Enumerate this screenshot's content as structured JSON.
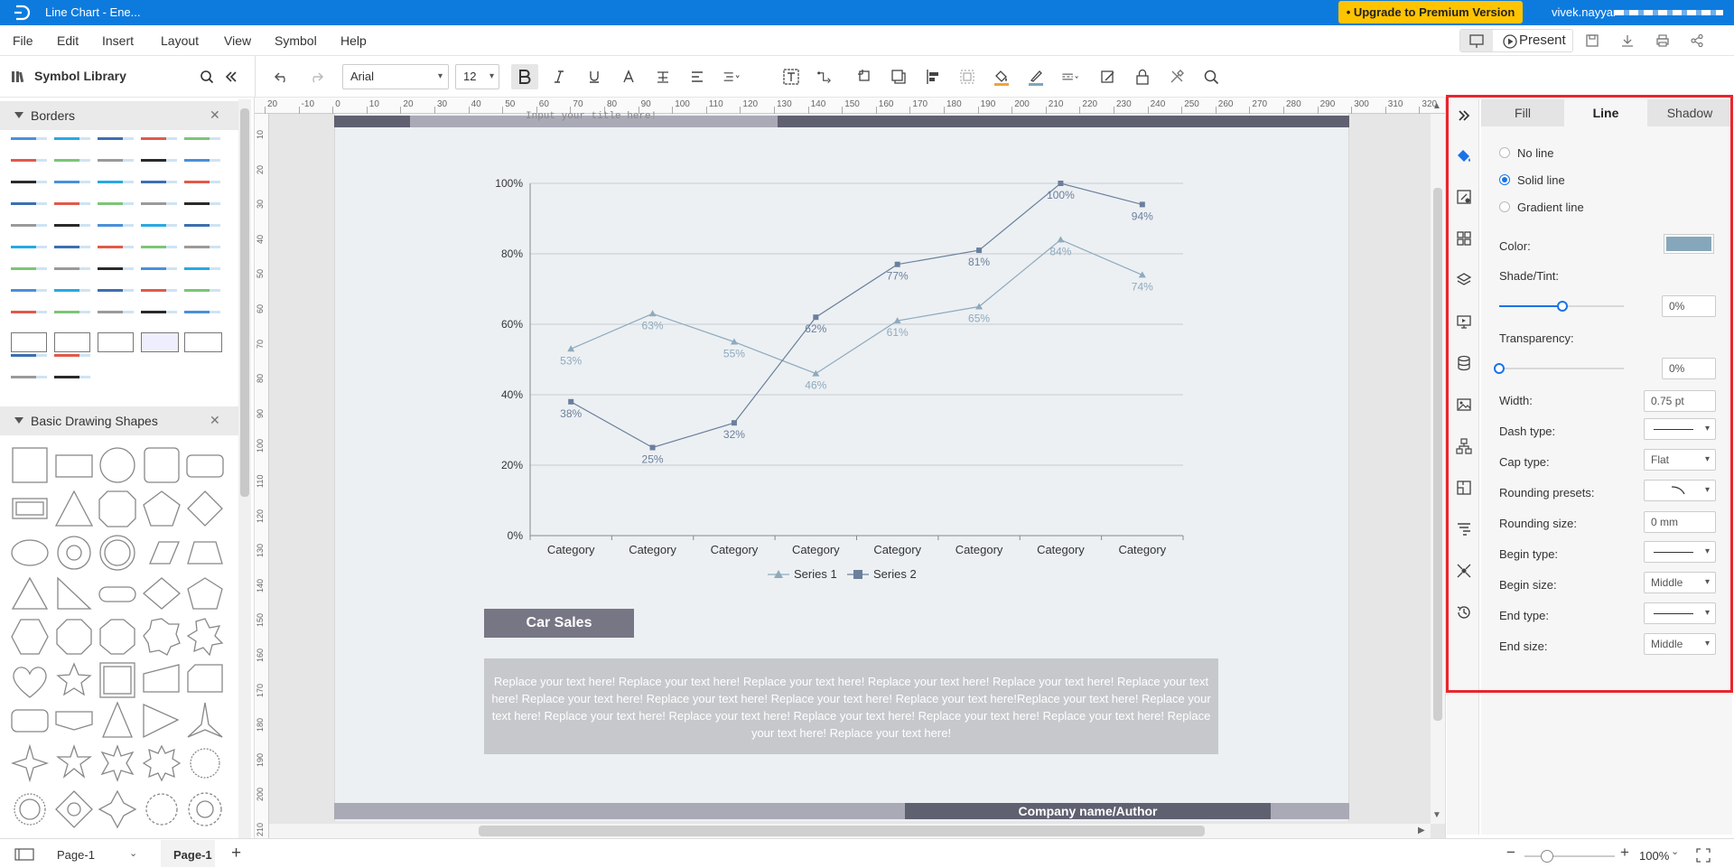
{
  "window": {
    "title": "Line Chart - Ene...",
    "upgrade_label": "• Upgrade to Premium Version",
    "user": "vivek.nayyar"
  },
  "menu": [
    "File",
    "Edit",
    "Insert",
    "Layout",
    "View",
    "Symbol",
    "Help"
  ],
  "present_label": "Present",
  "toolbar": {
    "font_family": "Arial",
    "font_size": "12"
  },
  "library": {
    "title": "Symbol Library",
    "sections": [
      {
        "name": "Borders"
      },
      {
        "name": "Basic Drawing Shapes"
      }
    ]
  },
  "ruler": {
    "top": [
      "20",
      "-10",
      "0",
      "10",
      "20",
      "30",
      "40",
      "50",
      "60",
      "70",
      "80",
      "90",
      "100",
      "110",
      "120",
      "130",
      "140",
      "150",
      "160",
      "170",
      "180",
      "190",
      "200",
      "210",
      "220",
      "230",
      "240",
      "250",
      "260",
      "270",
      "280",
      "290",
      "300",
      "310",
      "320"
    ],
    "left": [
      "10",
      "20",
      "30",
      "40",
      "50",
      "60",
      "70",
      "80",
      "90",
      "100",
      "110",
      "120",
      "130",
      "140",
      "150",
      "160",
      "170",
      "180",
      "190",
      "200",
      "210"
    ]
  },
  "document": {
    "title_placeholder": "Input your title here!",
    "car_sales": "Car Sales",
    "body_text": "Replace your text here!   Replace your text here!   Replace your text here!   Replace your text here!   Replace your text here! Replace your text here!   Replace your text here!   Replace your text here!   Replace your text here!   Replace your text here!Replace your text here!   Replace your text here!   Replace your text here!   Replace your text here!   Replace your text here!   Replace your text here!   Replace your text here!   Replace your text here!   Replace your text here!",
    "footer": "Company name/Author"
  },
  "chart_data": {
    "type": "line",
    "categories": [
      "Category",
      "Category",
      "Category",
      "Category",
      "Category",
      "Category",
      "Category",
      "Category"
    ],
    "series": [
      {
        "name": "Series 1",
        "values": [
          53,
          63,
          55,
          46,
          61,
          65,
          84,
          74
        ],
        "color": "#8faabd",
        "marker": "triangle"
      },
      {
        "name": "Series 2",
        "values": [
          38,
          25,
          32,
          62,
          77,
          81,
          100,
          94
        ],
        "color": "#6b7f9c",
        "marker": "square"
      }
    ],
    "ylim": [
      0,
      100
    ],
    "yticks": [
      "0%",
      "20%",
      "40%",
      "60%",
      "80%",
      "100%"
    ],
    "grid": true,
    "legend": "bottom"
  },
  "properties": {
    "tabs": [
      "Fill",
      "Line",
      "Shadow"
    ],
    "active_tab": "Line",
    "line_options": [
      "No line",
      "Solid line",
      "Gradient line"
    ],
    "selected_line_option": "Solid line",
    "color_label": "Color:",
    "color_value": "#86a7bb",
    "shade_label": "Shade/Tint:",
    "shade_value": "0%",
    "transparency_label": "Transparency:",
    "transparency_value": "0%",
    "width_label": "Width:",
    "width_value": "0.75 pt",
    "dash_label": "Dash type:",
    "cap_label": "Cap type:",
    "cap_value": "Flat",
    "rounding_presets_label": "Rounding presets:",
    "rounding_size_label": "Rounding size:",
    "rounding_size_value": "0 mm",
    "begin_type_label": "Begin type:",
    "begin_size_label": "Begin size:",
    "begin_size_value": "Middle",
    "end_type_label": "End type:",
    "end_size_label": "End size:",
    "end_size_value": "Middle"
  },
  "status": {
    "page_select": "Page-1",
    "page_tab": "Page-1",
    "zoom": "100%"
  }
}
